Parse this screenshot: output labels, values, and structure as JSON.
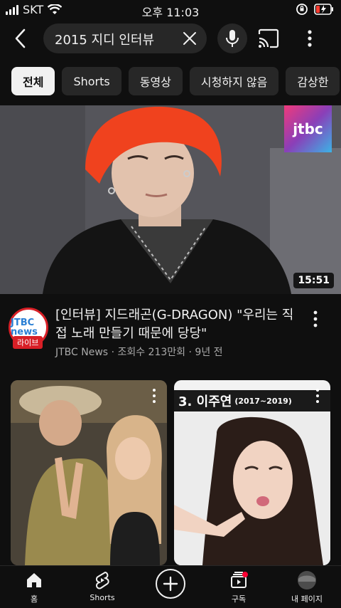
{
  "status_bar": {
    "carrier": "SKT",
    "time": "오후 11:03"
  },
  "search": {
    "query": "2015 지디 인터뷰"
  },
  "chips": [
    "전체",
    "Shorts",
    "동영상",
    "시청하지 않음",
    "감상한"
  ],
  "video": {
    "duration": "15:51",
    "thumb_logo": "jtbc",
    "title": "[인터뷰] 지드래곤(G-DRAGON) \"우리는 직접 노래 만들기 때문에 당당\"",
    "channel": "JTBC News",
    "views": "조회수 213만회",
    "age": "9년 전",
    "channel_avatar_text": "JTBC news",
    "live_badge": "라이브"
  },
  "shorts": [
    {
      "headline_text": ""
    },
    {
      "headline_text": "3. 이주연",
      "headline_years": "(2017~2019)"
    }
  ],
  "bottom_nav": {
    "home": "홈",
    "shorts": "Shorts",
    "subscriptions": "구독",
    "you": "내 페이지"
  },
  "colors": {
    "background": "#0f0f0f",
    "chip_bg": "#272727",
    "chip_active_bg": "#f1f1f1",
    "accent_red": "#d81f26"
  }
}
